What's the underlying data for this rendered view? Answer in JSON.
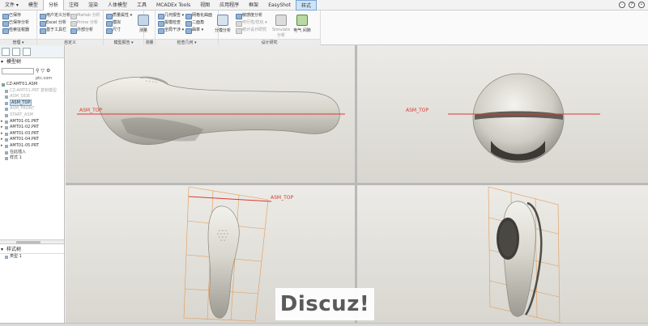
{
  "menubar": {
    "items": [
      "文件 ▾",
      "模型",
      "分析",
      "注释",
      "渲染",
      "人体模型",
      "工具",
      "MCADEx Tools",
      "视图",
      "应用程序",
      "框架",
      "EasyShot",
      "样式"
    ],
    "active_index": 2,
    "highlight_index": 12
  },
  "ribbon": {
    "groups": [
      {
        "label": "管理 ▾",
        "items": [
          "已保存",
          "已保存分析",
          "检索征税器"
        ]
      },
      {
        "label": "自定义",
        "items": [
          "用户定义分析",
          "Excel 分析",
          "基于工具栏",
          "Matlab 分析",
          "Prime 分析",
          "外部分析"
        ]
      },
      {
        "label": "模型报告 ▾",
        "items": [
          "质量属性 ▾",
          "模拟",
          "尺寸"
        ]
      },
      {
        "label": "测量",
        "items": [
          "测量"
        ]
      },
      {
        "label": "检查几何 ▾",
        "items": [
          "几何报告 ▾",
          "拔模检查",
          "全局干涉 ▾",
          "网格化曲面",
          "二面角",
          "曲率 ▾"
        ]
      },
      {
        "label": "设计研究",
        "items": [
          "敏感度分析",
          "可行性/优化 ▾",
          "统计设计研究",
          "分模分析",
          "Simulate 分析",
          "电气 间隙"
        ]
      }
    ]
  },
  "left_panel": {
    "model_tree_title": "模型树",
    "site_label": "ptc.com",
    "tree": [
      {
        "label": "CZ-AMT01.ASM",
        "level": 0,
        "style": "normal"
      },
      {
        "label": "CZ-AMT01.PRT 复制模型",
        "level": 1,
        "style": "grey"
      },
      {
        "label": "ASM_SIDE",
        "level": 1,
        "style": "grey"
      },
      {
        "label": "ASM_TOP",
        "level": 1,
        "style": "selected"
      },
      {
        "label": "ASM_FRONT",
        "level": 1,
        "style": "grey"
      },
      {
        "label": "START_ASM",
        "level": 1,
        "style": "grey"
      },
      {
        "label": "AMT01-01.PRT",
        "level": 1,
        "style": "normal"
      },
      {
        "label": "AMT01-02.PRT",
        "level": 1,
        "style": "normal"
      },
      {
        "label": "AMT01-03.PRT",
        "level": 1,
        "style": "normal"
      },
      {
        "label": "AMT01-04.PRT",
        "level": 1,
        "style": "normal"
      },
      {
        "label": "AMT01-05.PRT",
        "level": 1,
        "style": "normal"
      },
      {
        "label": "在此插入",
        "level": 1,
        "style": "normal"
      },
      {
        "label": "样式 1",
        "level": 1,
        "style": "normal"
      }
    ],
    "style_tree_title": "样式树",
    "style_tree": [
      {
        "label": "类型 1"
      }
    ]
  },
  "viewport": {
    "plane_label": "ASM_TOP",
    "toolbar_icons": [
      "refit-icon",
      "zoom-in-icon",
      "zoom-out-icon",
      "repaint-icon",
      "display-style-icon",
      "view-orient-icon",
      "saved-views-icon",
      "datum-display-icon",
      "spin-center-icon",
      "annotation-icon",
      "plane-display-icon",
      "axis-display-icon",
      "point-display-icon",
      "csys-display-icon"
    ]
  },
  "watermark": "Discuz!",
  "colors": {
    "body": "#c9c7bd",
    "plane": "#d93a2f",
    "frame": "#e39a56",
    "viewport_bg": "#e8e6e1",
    "ribbon_bg": "#fafafa"
  }
}
